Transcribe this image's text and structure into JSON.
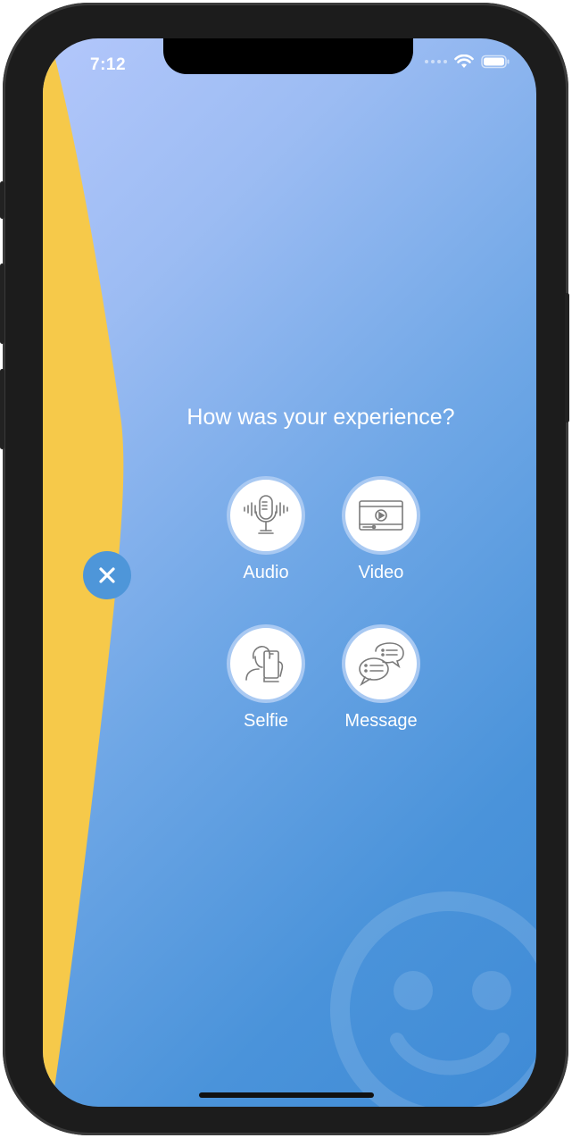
{
  "status_bar": {
    "time": "7:12"
  },
  "prompt": {
    "title": "How was your experience?"
  },
  "options": [
    {
      "label": "Audio",
      "icon": "microphone-icon"
    },
    {
      "label": "Video",
      "icon": "video-player-icon"
    },
    {
      "label": "Selfie",
      "icon": "selfie-icon"
    },
    {
      "label": "Message",
      "icon": "chat-bubbles-icon"
    }
  ],
  "colors": {
    "accent_yellow": "#f6c94a",
    "gradient_top": "#b3c7fb",
    "gradient_bottom": "#3f8bd6",
    "close_button": "#4e96d9"
  },
  "icons": {
    "close": "close-icon",
    "decor": "smiley-icon"
  }
}
